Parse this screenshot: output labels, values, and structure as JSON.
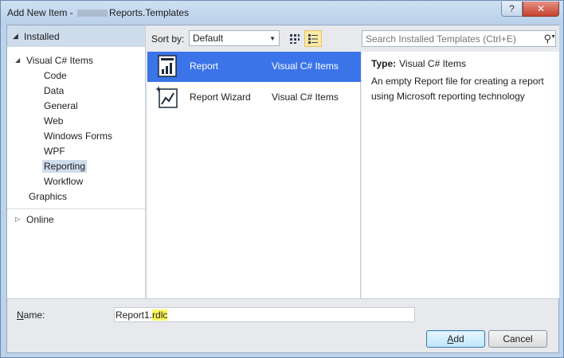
{
  "window": {
    "title_prefix": "Add New Item - ",
    "title_suffix": "Reports.Templates",
    "help_label": "?",
    "close_label": "✕"
  },
  "left_pane": {
    "installed_label": "Installed",
    "tree": [
      {
        "label": "Visual C# Items",
        "expanded": true
      },
      {
        "label": "Code"
      },
      {
        "label": "Data"
      },
      {
        "label": "General"
      },
      {
        "label": "Web"
      },
      {
        "label": "Windows Forms"
      },
      {
        "label": "WPF"
      },
      {
        "label": "Reporting",
        "selected": true
      },
      {
        "label": "Workflow"
      },
      {
        "label": "Graphics"
      }
    ],
    "online_label": "Online"
  },
  "toolbar": {
    "sort_label": "Sort by:",
    "sort_value": "Default",
    "search_placeholder": "Search Installed Templates (Ctrl+E)"
  },
  "templates": [
    {
      "name": "Report",
      "language": "Visual C# Items",
      "icon": "report-icon",
      "selected": true
    },
    {
      "name": "Report Wizard",
      "language": "Visual C# Items",
      "icon": "report-wizard-icon"
    }
  ],
  "detail": {
    "type_label": "Type:",
    "type_value": "Visual C# Items",
    "description": "An empty Report file for creating a report using Microsoft reporting technology"
  },
  "footer": {
    "name_label_underlined": "N",
    "name_label_rest": "ame:",
    "name_value_base": "Report1.",
    "name_value_ext": "rdlc",
    "add_label_underlined": "A",
    "add_label_rest": "dd",
    "cancel_label": "Cancel"
  }
}
